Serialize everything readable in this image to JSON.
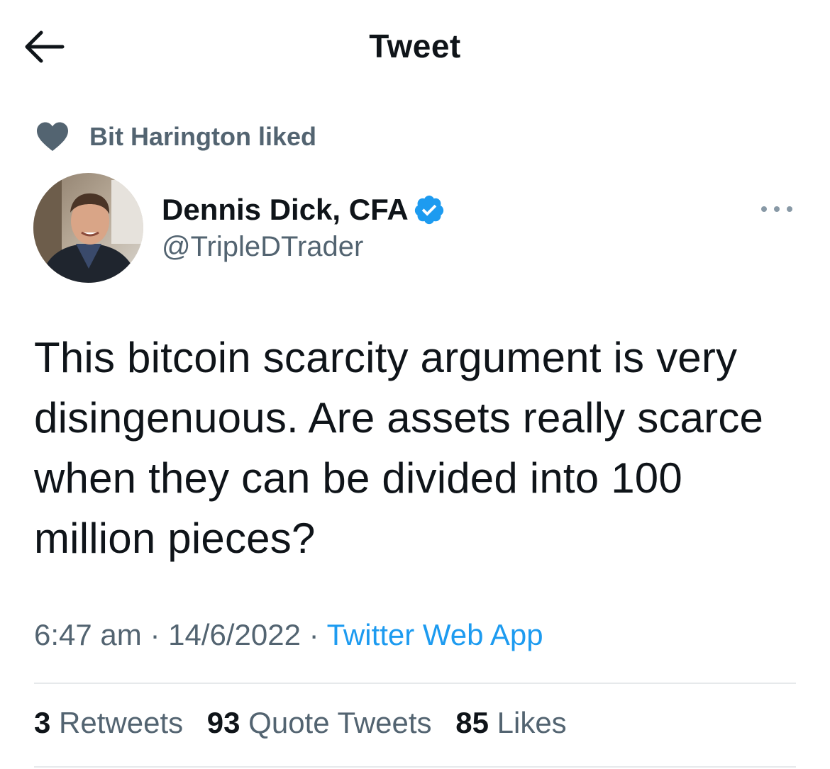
{
  "header": {
    "title": "Tweet",
    "back_icon": "arrow-left-icon"
  },
  "social_context": {
    "icon": "heart-icon",
    "text": "Bit Harington liked"
  },
  "author": {
    "name": "Dennis Dick, CFA",
    "handle": "@TripleDTrader",
    "verified": true,
    "verified_icon": "verified-badge-icon",
    "more_icon": "more-horizontal-icon"
  },
  "tweet": {
    "text": "This bitcoin scarcity argument is very disingenuous. Are assets really scarce when they can be divided into 100 million pieces?"
  },
  "meta": {
    "time": "6:47 am",
    "separator": "·",
    "date": "14/6/2022",
    "source": "Twitter Web App"
  },
  "stats": {
    "retweets_count": "3",
    "retweets_label": "Retweets",
    "quote_tweets_count": "93",
    "quote_tweets_label": "Quote Tweets",
    "likes_count": "85",
    "likes_label": "Likes"
  },
  "colors": {
    "accent": "#1d9bf0",
    "secondary_text": "#536471",
    "primary_text": "#0f1419",
    "divider": "#e6e9eb"
  }
}
